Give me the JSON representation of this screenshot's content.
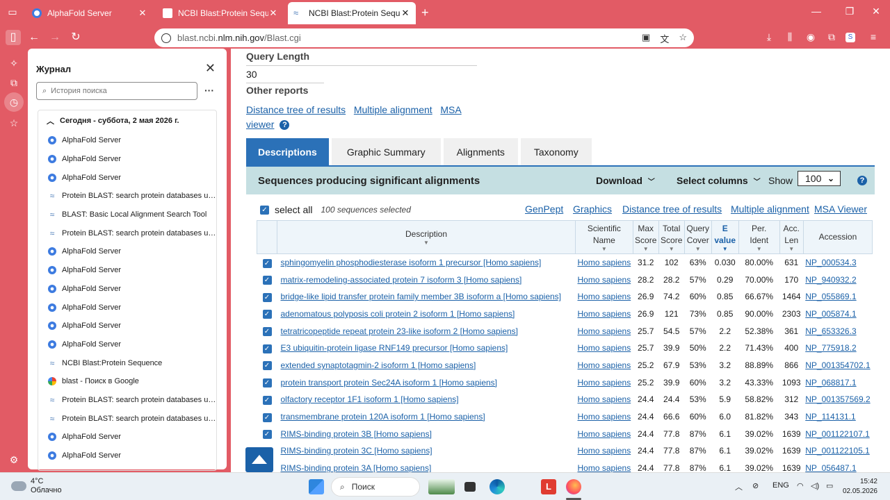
{
  "browser": {
    "tabs": [
      {
        "title": "AlphaFold Server",
        "active": false
      },
      {
        "title": "NCBI Blast:Protein Sequence",
        "active": false
      },
      {
        "title": "NCBI Blast:Protein Sequence",
        "active": true
      }
    ],
    "url_prefix": "blast.ncbi.",
    "url_domain": "nlm.nih.gov",
    "url_path": "/Blast.cgi"
  },
  "history": {
    "title": "Журнал",
    "search_placeholder": "История поиска",
    "group_label": "Сегодня - суббота, 2 мая 2026 г.",
    "items": [
      {
        "label": "AlphaFold Server",
        "icon": "af"
      },
      {
        "label": "AlphaFold Server",
        "icon": "af"
      },
      {
        "label": "AlphaFold Server",
        "icon": "af"
      },
      {
        "label": "Protein BLAST: search protein databases using ...",
        "icon": "ncbi"
      },
      {
        "label": "BLAST: Basic Local Alignment Search Tool",
        "icon": "ncbi"
      },
      {
        "label": "Protein BLAST: search protein databases using ...",
        "icon": "ncbi"
      },
      {
        "label": "AlphaFold Server",
        "icon": "af"
      },
      {
        "label": "AlphaFold Server",
        "icon": "af"
      },
      {
        "label": "AlphaFold Server",
        "icon": "af"
      },
      {
        "label": "AlphaFold Server",
        "icon": "af"
      },
      {
        "label": "AlphaFold Server",
        "icon": "af"
      },
      {
        "label": "AlphaFold Server",
        "icon": "af"
      },
      {
        "label": "NCBI Blast:Protein Sequence",
        "icon": "ncbi"
      },
      {
        "label": "blast - Поиск в Google",
        "icon": "g"
      },
      {
        "label": "Protein BLAST: search protein databases using ...",
        "icon": "ncbi"
      },
      {
        "label": "Protein BLAST: search protein databases using ...",
        "icon": "ncbi"
      },
      {
        "label": "AlphaFold Server",
        "icon": "af"
      },
      {
        "label": "AlphaFold Server",
        "icon": "af"
      }
    ]
  },
  "page": {
    "query_length_label": "Query Length",
    "query_length_value": "30",
    "other_reports_label": "Other reports",
    "link_distance_tree": "Distance tree of results",
    "link_multiple_alignment": "Multiple alignment",
    "link_msa_viewer": "MSA viewer",
    "tabs": [
      "Descriptions",
      "Graphic Summary",
      "Alignments",
      "Taxonomy"
    ],
    "results_title": "Sequences producing significant alignments",
    "download_label": "Download",
    "select_columns_label": "Select columns",
    "show_label": "Show",
    "show_value": "100",
    "select_all_label": "select all",
    "selected_count": "100 sequences selected",
    "top_links": [
      "GenPept",
      "Graphics",
      "Distance tree of results",
      "Multiple alignment",
      "MSA Viewer"
    ],
    "columns": [
      {
        "line1": "Description",
        "line2": ""
      },
      {
        "line1": "Scientific",
        "line2": "Name"
      },
      {
        "line1": "Max",
        "line2": "Score"
      },
      {
        "line1": "Total",
        "line2": "Score"
      },
      {
        "line1": "Query",
        "line2": "Cover"
      },
      {
        "line1": "E",
        "line2": "value"
      },
      {
        "line1": "Per.",
        "line2": "Ident"
      },
      {
        "line1": "Acc.",
        "line2": "Len"
      },
      {
        "line1": "Accession",
        "line2": ""
      }
    ],
    "rows": [
      {
        "desc": "sphingomyelin phosphodiesterase isoform 1 precursor [Homo sapiens]",
        "sci": "Homo sapiens",
        "max": "31.2",
        "total": "102",
        "cover": "63%",
        "evalue": "0.030",
        "ident": "80.00%",
        "len": "631",
        "acc": "NP_000534.3"
      },
      {
        "desc": "matrix-remodeling-associated protein 7 isoform 3 [Homo sapiens]",
        "sci": "Homo sapiens",
        "max": "28.2",
        "total": "28.2",
        "cover": "57%",
        "evalue": "0.29",
        "ident": "70.00%",
        "len": "170",
        "acc": "NP_940932.2"
      },
      {
        "desc": "bridge-like lipid transfer protein family member 3B isoform a [Homo sapiens]",
        "sci": "Homo sapiens",
        "max": "26.9",
        "total": "74.2",
        "cover": "60%",
        "evalue": "0.85",
        "ident": "66.67%",
        "len": "1464",
        "acc": "NP_055869.1"
      },
      {
        "desc": "adenomatous polyposis coli protein 2 isoform 1 [Homo sapiens]",
        "sci": "Homo sapiens",
        "max": "26.9",
        "total": "121",
        "cover": "73%",
        "evalue": "0.85",
        "ident": "90.00%",
        "len": "2303",
        "acc": "NP_005874.1"
      },
      {
        "desc": "tetratricopeptide repeat protein 23-like isoform 2 [Homo sapiens]",
        "sci": "Homo sapiens",
        "max": "25.7",
        "total": "54.5",
        "cover": "57%",
        "evalue": "2.2",
        "ident": "52.38%",
        "len": "361",
        "acc": "NP_653326.3"
      },
      {
        "desc": "E3 ubiquitin-protein ligase RNF149 precursor [Homo sapiens]",
        "sci": "Homo sapiens",
        "max": "25.7",
        "total": "39.9",
        "cover": "50%",
        "evalue": "2.2",
        "ident": "71.43%",
        "len": "400",
        "acc": "NP_775918.2"
      },
      {
        "desc": "extended synaptotagmin-2 isoform 1 [Homo sapiens]",
        "sci": "Homo sapiens",
        "max": "25.2",
        "total": "67.9",
        "cover": "53%",
        "evalue": "3.2",
        "ident": "88.89%",
        "len": "866",
        "acc": "NP_001354702.1"
      },
      {
        "desc": "protein transport protein Sec24A isoform 1 [Homo sapiens]",
        "sci": "Homo sapiens",
        "max": "25.2",
        "total": "39.9",
        "cover": "60%",
        "evalue": "3.2",
        "ident": "43.33%",
        "len": "1093",
        "acc": "NP_068817.1"
      },
      {
        "desc": "olfactory receptor 1F1 isoform 1 [Homo sapiens]",
        "sci": "Homo sapiens",
        "max": "24.4",
        "total": "24.4",
        "cover": "53%",
        "evalue": "5.9",
        "ident": "58.82%",
        "len": "312",
        "acc": "NP_001357569.2"
      },
      {
        "desc": "transmembrane protein 120A isoform 1 [Homo sapiens]",
        "sci": "Homo sapiens",
        "max": "24.4",
        "total": "66.6",
        "cover": "60%",
        "evalue": "6.0",
        "ident": "81.82%",
        "len": "343",
        "acc": "NP_114131.1"
      },
      {
        "desc": "RIMS-binding protein 3B [Homo sapiens]",
        "sci": "Homo sapiens",
        "max": "24.4",
        "total": "77.8",
        "cover": "87%",
        "evalue": "6.1",
        "ident": "39.02%",
        "len": "1639",
        "acc": "NP_001122107.1"
      },
      {
        "desc": "RIMS-binding protein 3C [Homo sapiens]",
        "sci": "Homo sapiens",
        "max": "24.4",
        "total": "77.8",
        "cover": "87%",
        "evalue": "6.1",
        "ident": "39.02%",
        "len": "1639",
        "acc": "NP_001122105.1"
      },
      {
        "desc": "RIMS-binding protein 3A [Homo sapiens]",
        "sci": "Homo sapiens",
        "max": "24.4",
        "total": "77.8",
        "cover": "87%",
        "evalue": "6.1",
        "ident": "39.02%",
        "len": "1639",
        "acc": "NP_056487.1"
      }
    ]
  },
  "taskbar": {
    "temp": "4°C",
    "weather": "Облачно",
    "search_label": "Поиск",
    "lang": "ENG",
    "time": "15:42",
    "date": "02.05.2026"
  },
  "colors": {
    "browser_accent": "#e25b65",
    "ncbi_blue": "#2b71b8",
    "link": "#1b61a8",
    "header_band": "#c5dfe2"
  }
}
